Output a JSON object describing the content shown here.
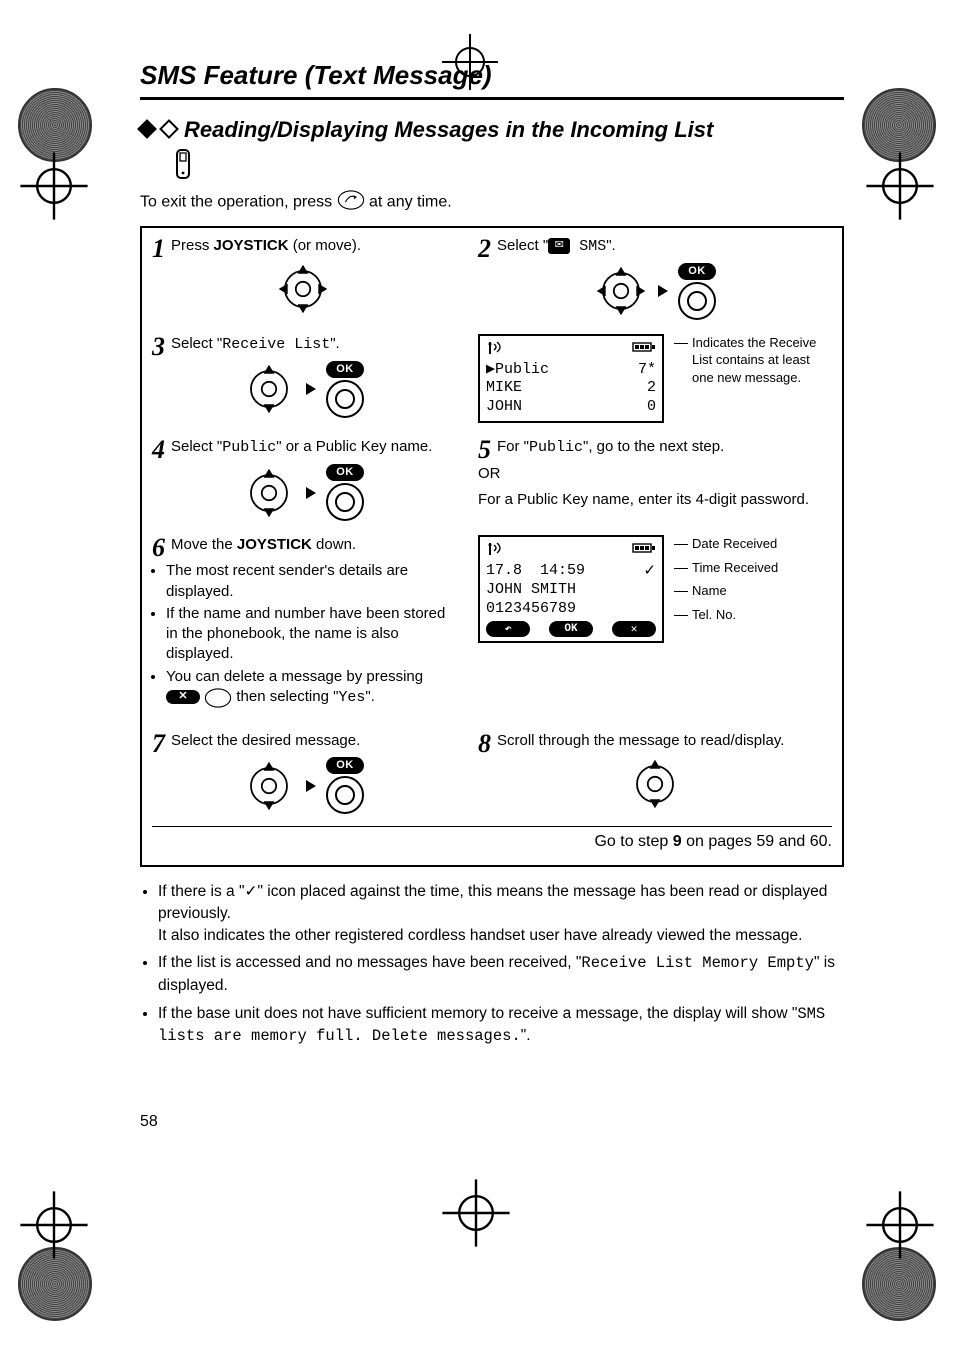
{
  "page_number": "58",
  "section_title": "SMS Feature (Text Message)",
  "subtitle": "Reading/Displaying Messages in the Incoming List",
  "intro_pre": "To exit the operation, press",
  "intro_post": "at any time.",
  "ok_label": "OK",
  "steps": {
    "s1_num": "1",
    "s1_a": "Press ",
    "s1_joy": "JOYSTICK",
    "s1_b": " (or move).",
    "s2_num": "2",
    "s2_a": "Select \"",
    "s2_sms": " SMS",
    "s2_b": "\".",
    "s3_num": "3",
    "s3_a": "Select \"",
    "s3_rx": "Receive List",
    "s3_b": "\".",
    "s3_lcd_row1_l": "▶Public",
    "s3_lcd_row1_r": "7*",
    "s3_lcd_row2_l": " MIKE",
    "s3_lcd_row2_r": "2",
    "s3_lcd_row3_l": " JOHN",
    "s3_lcd_row3_r": "0",
    "s3_callout": "Indicates the Receive List contains at least one new message.",
    "s4_num": "4",
    "s4_a": "Select \"",
    "s4_pub": "Public",
    "s4_b": "\" or a Public Key name.",
    "s5_num": "5",
    "s5_a": "For \"",
    "s5_pub": "Public",
    "s5_b": "\", go to the next step.",
    "s5_or": "OR",
    "s5_c": "For a Public Key name, enter its 4-digit password.",
    "s6_num": "6",
    "s6_a": "Move the ",
    "s6_joy": "JOYSTICK",
    "s6_b": " down.",
    "s6_bul1": "The most recent sender's details are displayed.",
    "s6_bul2": "If the name and number have been stored in the phonebook, the name is also displayed.",
    "s6_bul3a": "You can delete a message by pressing ",
    "s6_bul3b": " then selecting \"",
    "s6_yes": "Yes",
    "s6_bul3c": "\".",
    "s6_lcd_date": "17.8",
    "s6_lcd_time": "14:59",
    "s6_lcd_name": "JOHN SMITH",
    "s6_lcd_tel": "0123456789",
    "s6_lcd_sk_back": "↶",
    "s6_lcd_sk_ok": "OK",
    "s6_lcd_sk_x": "✕",
    "s6_c_date": "Date Received",
    "s6_c_time": "Time Received",
    "s6_c_name": "Name",
    "s6_c_tel": "Tel. No.",
    "s7_num": "7",
    "s7_a": "Select the desired message.",
    "s8_num": "8",
    "s8_a": "Scroll through the message to read/display.",
    "footer_a": "Go to step ",
    "footer_b": "9",
    "footer_c": " on pages 59 and 60."
  },
  "notes": {
    "n1a": "If there is a \"",
    "n1b": "\" icon placed against the time, this means the message has been read or displayed previously.",
    "n1c": "It also indicates the other registered cordless handset user have already viewed the message.",
    "n2a": "If the list is accessed and no messages have been received, \"",
    "n2b": "Receive List Memory Empty",
    "n2c": "\" is displayed.",
    "n3a": "If the base unit does not have sufficient memory to receive a message, the display will show \"",
    "n3b": "SMS lists are memory full. Delete messages.",
    "n3c": "\"."
  },
  "icons": {
    "check": "✓",
    "x": "✕",
    "back": "↶",
    "envelope": "✉",
    "battery": "▭",
    "signal": "📶"
  }
}
